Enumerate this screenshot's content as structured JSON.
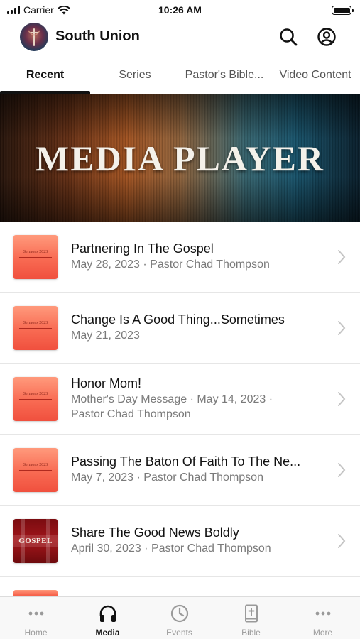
{
  "status_bar": {
    "carrier": "Carrier",
    "time": "10:26 AM"
  },
  "header": {
    "title": "South Union"
  },
  "tabs": [
    {
      "label": "Recent",
      "active": true
    },
    {
      "label": "Series",
      "active": false
    },
    {
      "label": "Pastor's Bible...",
      "active": false
    },
    {
      "label": "Video Content",
      "active": false
    }
  ],
  "banner": {
    "text": "MEDIA PLAYER"
  },
  "media_items": [
    {
      "title": "Partnering In The Gospel",
      "subtitle": "May 28, 2023 · Pastor Chad Thompson",
      "thumb_text": "Sermons 2023"
    },
    {
      "title": "Change Is A Good Thing...Sometimes",
      "subtitle": "May 21, 2023",
      "thumb_text": "Sermons 2023"
    },
    {
      "title": "Honor Mom!",
      "subtitle_line1": "Mother's Day Message · May 14, 2023 ·",
      "subtitle_line2": "Pastor Chad Thompson",
      "thumb_text": "Sermons 2023"
    },
    {
      "title": "Passing The Baton Of Faith To The Ne...",
      "subtitle": "May 7, 2023 · Pastor Chad Thompson",
      "thumb_text": "Sermons 2023"
    },
    {
      "title": "Share The Good News Boldly",
      "subtitle": "April 30, 2023 · Pastor Chad Thompson",
      "thumb_text": "GOSPEL"
    }
  ],
  "bottom_nav": [
    {
      "label": "Home",
      "icon": "dots-icon",
      "active": false
    },
    {
      "label": "Media",
      "icon": "headphones-icon",
      "active": true
    },
    {
      "label": "Events",
      "icon": "clock-icon",
      "active": false
    },
    {
      "label": "Bible",
      "icon": "bible-icon",
      "active": false
    },
    {
      "label": "More",
      "icon": "dots-icon",
      "active": false
    }
  ],
  "colors": {
    "accent": "#111111",
    "inactive": "#9a9a9a",
    "subtitle": "#7a7a7a",
    "thumb_sermon": "#f86a52",
    "thumb_gospel": "#a3161b"
  }
}
